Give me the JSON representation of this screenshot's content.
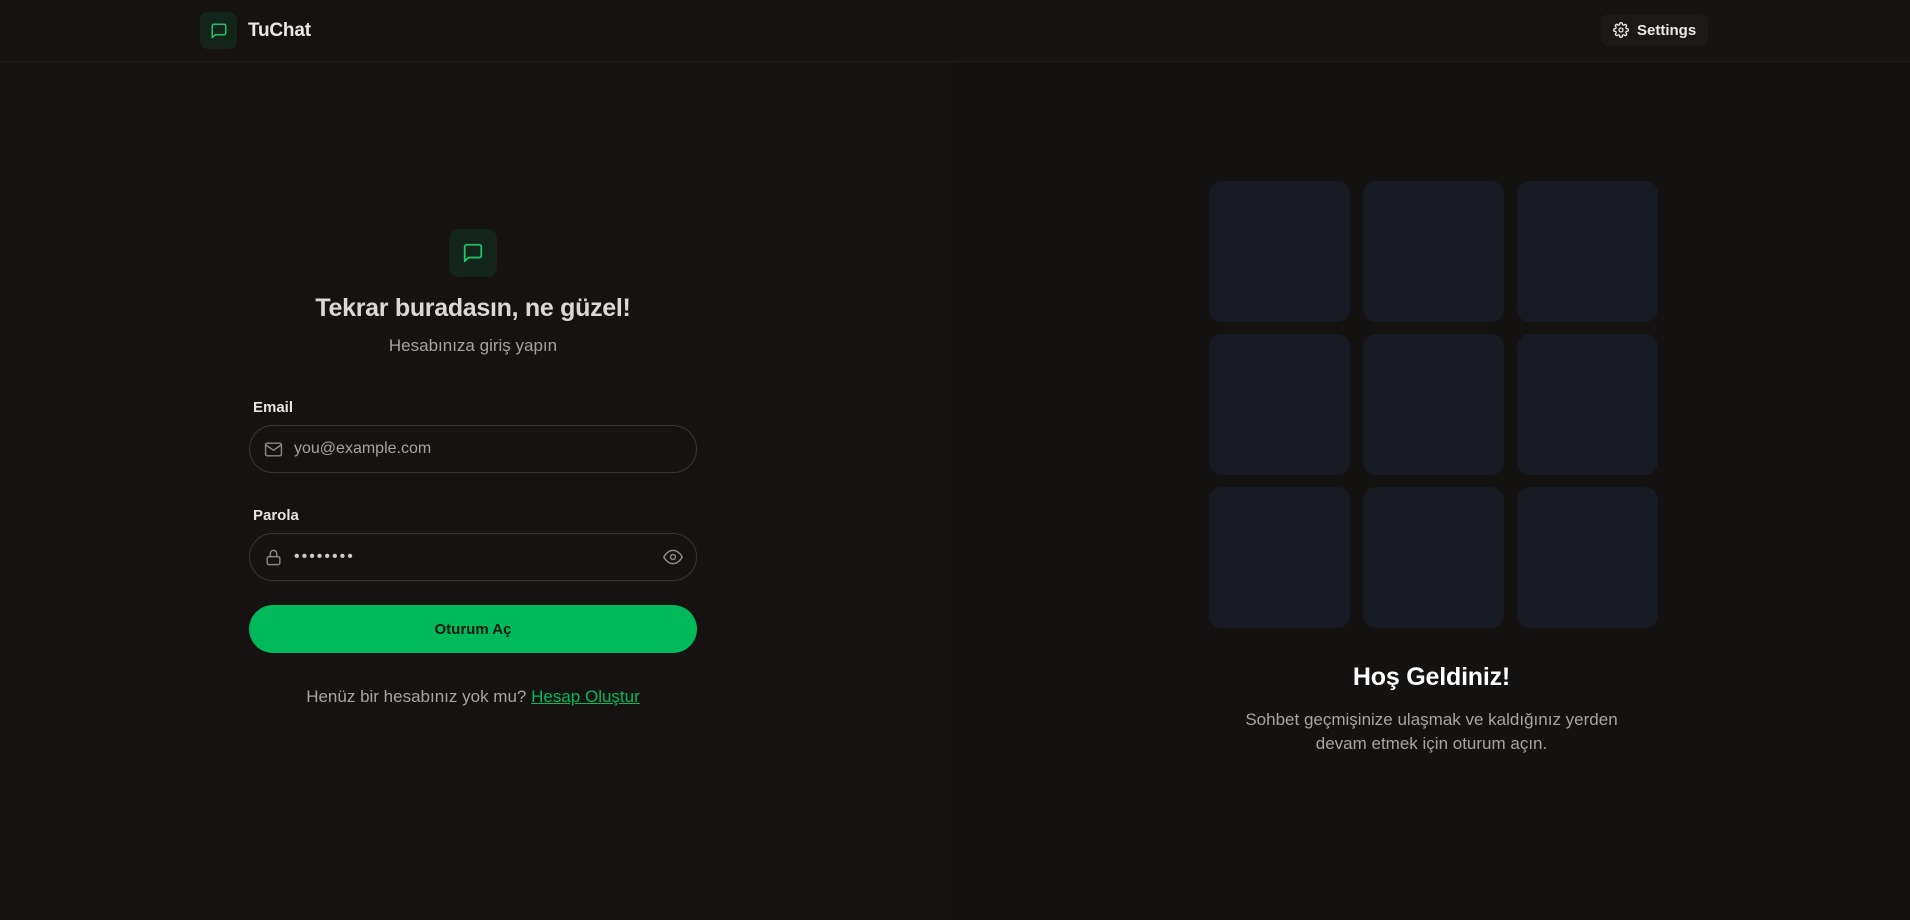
{
  "header": {
    "brand_name": "TuChat",
    "brand_icon": "message-square-icon",
    "settings_label": "Settings",
    "settings_icon": "gear-icon"
  },
  "login": {
    "title": "Tekrar buradasın, ne güzel!",
    "subtitle": "Hesabınıza giriş yapın",
    "email": {
      "label": "Email",
      "placeholder": "you@example.com",
      "value": "",
      "icon": "mail-icon"
    },
    "password": {
      "label": "Parola",
      "value": "••••••••",
      "icon": "lock-icon",
      "toggle_icon": "eye-icon"
    },
    "submit_label": "Oturum Aç",
    "signup_prompt": "Henüz bir hesabınız yok mu?",
    "signup_link": "Hesap Oluştur"
  },
  "welcome": {
    "title": "Hoş Geldiniz!",
    "description": "Sohbet geçmişinize ulaşmak ve kaldığınız yerden devam etmek için oturum açın."
  },
  "colors": {
    "accent": "#00b95b",
    "background": "#161212",
    "tile": "#181a23"
  }
}
